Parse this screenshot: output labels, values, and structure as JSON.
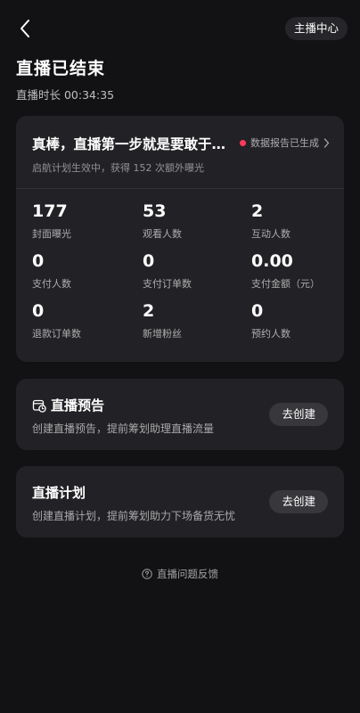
{
  "header": {
    "back_icon": "chevron-left-icon",
    "host_center_label": "主播中心"
  },
  "summary": {
    "title": "直播已结束",
    "duration_text": "直播时长 00:34:35"
  },
  "stats_card": {
    "headline": "真棒，直播第一步就是要敢于…",
    "report_status": "数据报告已生成",
    "report_dot_color": "#ff3b5c",
    "subline": "启航计划生效中，获得 152 次额外曝光",
    "metrics": [
      {
        "value": "177",
        "label": "封面曝光"
      },
      {
        "value": "53",
        "label": "观看人数"
      },
      {
        "value": "2",
        "label": "互动人数"
      },
      {
        "value": "0",
        "label": "支付人数"
      },
      {
        "value": "0",
        "label": "支付订单数"
      },
      {
        "value": "0.00",
        "label": "支付金额（元）"
      },
      {
        "value": "0",
        "label": "退款订单数"
      },
      {
        "value": "2",
        "label": "新增粉丝"
      },
      {
        "value": "0",
        "label": "预约人数"
      }
    ]
  },
  "preview_card": {
    "icon": "calendar-clock-icon",
    "title": "直播预告",
    "description": "创建直播预告，提前筹划助理直播流量",
    "button_label": "去创建"
  },
  "plan_card": {
    "title": "直播计划",
    "description": "创建直播计划，提前筹划助力下场备货无忧",
    "button_label": "去创建"
  },
  "footer": {
    "icon": "question-circle-icon",
    "feedback_label": "直播问题反馈"
  }
}
